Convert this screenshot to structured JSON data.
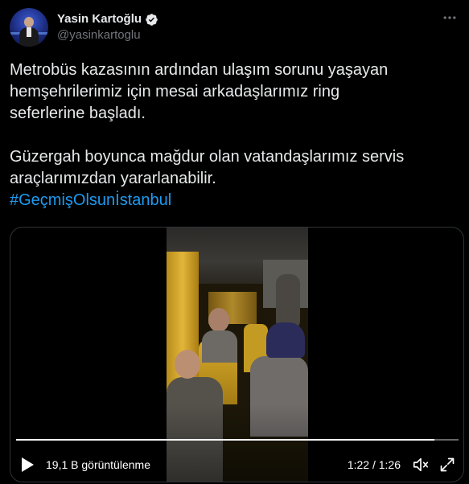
{
  "author": {
    "display_name": "Yasin Kartoğlu",
    "handle": "@yasinkartoglu",
    "verified": true
  },
  "icons": {
    "verified": "verified-badge-icon",
    "more": "more-options-icon",
    "play": "play-icon",
    "volume": "volume-icon",
    "fullscreen": "fullscreen-icon"
  },
  "tweet": {
    "paragraph_1": "Metrobüs kazasının ardından ulaşım sorunu yaşayan\nhemşehrilerimiz için mesai arkadaşlarımız ring\nseferlerine başladı.",
    "paragraph_2": "Güzergah boyunca mağdur olan vatandaşlarımız servis\naraçlarımızdan yararlanabilir.",
    "hashtag": "#GeçmişOlsunİstanbul"
  },
  "video": {
    "views": "19,1 B görüntülenme",
    "time": "1:22 / 1:26",
    "progress": 0.946
  },
  "colors": {
    "background": "#000000",
    "text": "#e7e9ea",
    "secondary": "#71767b",
    "accent": "#1d9bf0",
    "border": "#2f3336"
  }
}
